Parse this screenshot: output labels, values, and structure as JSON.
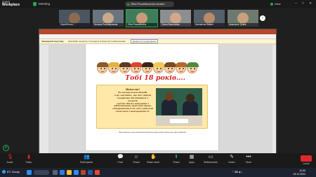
{
  "app": {
    "zoom_label": "zoom",
    "workplace_label": "Workplace",
    "meeting_title": "Meeting",
    "share_status": "Olha Praxeltsovna's screen",
    "view_label": "View"
  },
  "participants": [
    {
      "name": "Сергій Кооо..."
    },
    {
      "name": "Беланж Ресомаразова"
    },
    {
      "name": "Olha Praxeltsovna"
    },
    {
      "name": "Ольга Васильєва"
    },
    {
      "name": "Костянтин Бакалі"
    },
    {
      "name": "Анастасія Тулиж"
    }
  ],
  "powerpoint": {
    "warning_bold": "Захищений перегляд",
    "warning_text": "Цей файл походить із Інтернету й може бути небезпечним.",
    "warning_button": "Дозволити редагування"
  },
  "slide": {
    "title": "Тобі  18 років….",
    "card_lines": [
      "Вітаємо!",
      "Ти тепер повнолітній,",
      "а це значить, що ти стаєш",
      "повністю дієздатним і можеш",
      "своїми діями набувати і",
      "здійснювати цивільні права,",
      "створювати для себе цивільні",
      "обов'язки і виконувати їх."
    ],
    "url": "https://www.kmr.gov.ua/uk/content/yak-otrymaty-pravovu-dopomogu-dlya-molodi-18"
  },
  "toolbar": {
    "items": [
      {
        "label": "Audio",
        "icon": "mic-muted-icon"
      },
      {
        "label": "Video",
        "icon": "video-off-icon"
      },
      {
        "label": "Participants",
        "icon": "participants-icon"
      },
      {
        "label": "Chat",
        "icon": "chat-icon"
      },
      {
        "label": "React",
        "icon": "react-icon"
      },
      {
        "label": "Raise hand",
        "icon": "raise-hand-icon"
      },
      {
        "label": "Share",
        "icon": "share-icon"
      },
      {
        "label": "Apps",
        "icon": "apps-icon"
      },
      {
        "label": "Whiteboards",
        "icon": "whiteboard-icon"
      },
      {
        "label": "Notes",
        "icon": "notes-icon"
      },
      {
        "label": "More",
        "icon": "more-icon"
      }
    ],
    "leave_label": "Leave"
  },
  "taskbar": {
    "weather": "8°C Cloudy",
    "time": "12:33",
    "date": "23.12.2024"
  },
  "colors": {
    "accent_green": "#2da44e",
    "leave_red": "#e02828",
    "slide_title_red": "#d8232a",
    "card_yellow": "#ffe8a8"
  }
}
